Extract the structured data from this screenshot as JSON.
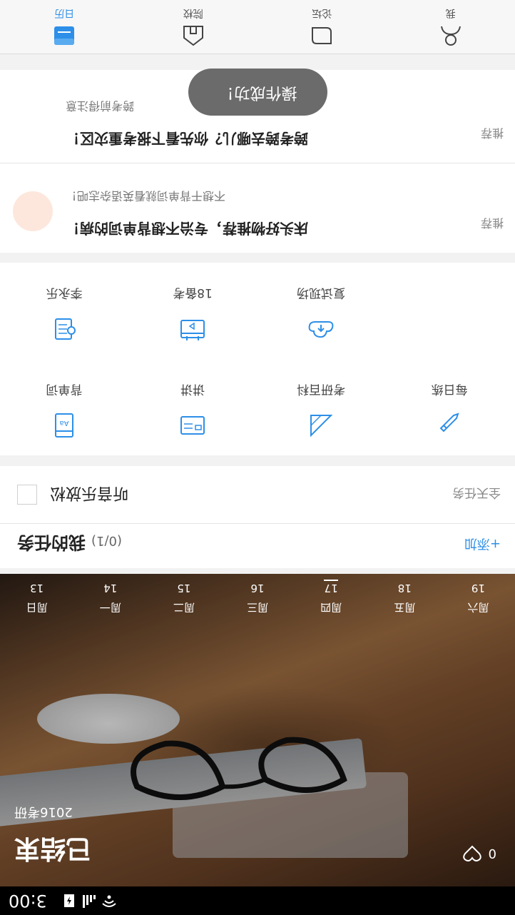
{
  "status_bar": {
    "time": "3:00"
  },
  "hero": {
    "title": "已结束",
    "subtitle": "2016考研",
    "like_count": "0",
    "week": [
      {
        "name": "周日",
        "num": "13"
      },
      {
        "name": "周一",
        "num": "14"
      },
      {
        "name": "周二",
        "num": "15"
      },
      {
        "name": "周三",
        "num": "16"
      },
      {
        "name": "周四",
        "num": "17",
        "today": true
      },
      {
        "name": "周五",
        "num": "18"
      },
      {
        "name": "周六",
        "num": "19"
      }
    ]
  },
  "tasks": {
    "title": "我的任务",
    "count": "(0/1)",
    "add_label": "+添加",
    "item": {
      "text": "听音乐放松",
      "tag": "全天任务"
    }
  },
  "tools": [
    {
      "label": "背单词",
      "icon": "vocab-card-icon"
    },
    {
      "label": "讲讲",
      "icon": "message-card-icon"
    },
    {
      "label": "考研百科",
      "icon": "ruler-triangle-icon"
    },
    {
      "label": "每日练",
      "icon": "pen-icon"
    },
    {
      "label": "李永乐",
      "icon": "tutor-icon"
    },
    {
      "label": "18备考",
      "icon": "calendar-box-icon"
    },
    {
      "label": "复试现场",
      "icon": "cloud-upload-icon"
    }
  ],
  "recs": [
    {
      "title": "床头好物推荐，专治不想背单词的病！",
      "subtitle": "不想干背单词就看英语杂志吧！",
      "tag": "推荐"
    },
    {
      "title": "跨考跨去哪儿？你先看下报考重灾区！",
      "subtitle": "跨考前得注意",
      "tag": "推荐"
    }
  ],
  "toast": "操作成功！",
  "nav": [
    {
      "label": "日历",
      "icon": "calendar-icon",
      "active": true
    },
    {
      "label": "院校",
      "icon": "school-icon"
    },
    {
      "label": "论坛",
      "icon": "forum-icon"
    },
    {
      "label": "我",
      "icon": "profile-icon"
    }
  ],
  "colors": {
    "accent": "#2d8fe8",
    "toast_bg": "#6b6b6b"
  }
}
